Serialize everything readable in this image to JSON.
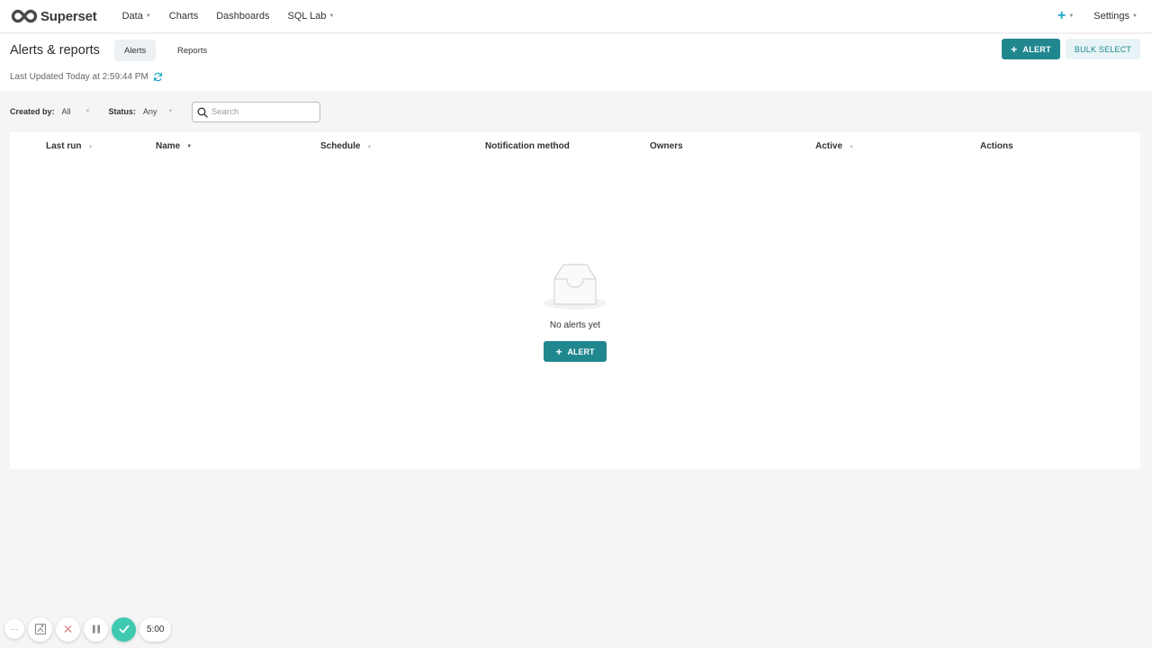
{
  "brand": {
    "name": "Superset"
  },
  "nav": {
    "items": [
      {
        "label": "Data",
        "dropdown": true
      },
      {
        "label": "Charts",
        "dropdown": false
      },
      {
        "label": "Dashboards",
        "dropdown": false
      },
      {
        "label": "SQL Lab",
        "dropdown": true
      }
    ],
    "settings_label": "Settings",
    "plus_symbol": "+"
  },
  "page": {
    "title": "Alerts & reports",
    "tabs": [
      {
        "label": "Alerts",
        "active": true
      },
      {
        "label": "Reports",
        "active": false
      }
    ],
    "alert_button": "ALERT",
    "bulk_select_button": "BULK SELECT",
    "last_updated": "Last Updated Today at 2:59:44 PM"
  },
  "filters": {
    "created_by_label": "Created by:",
    "created_by_value": "All",
    "status_label": "Status:",
    "status_value": "Any",
    "search_placeholder": "Search"
  },
  "table": {
    "columns": [
      {
        "label": "Last run",
        "sortable": true
      },
      {
        "label": "Name",
        "sortable": true,
        "sorted": "desc"
      },
      {
        "label": "Schedule",
        "sortable": true
      },
      {
        "label": "Notification method",
        "sortable": false
      },
      {
        "label": "Owners",
        "sortable": false
      },
      {
        "label": "Active",
        "sortable": true
      },
      {
        "label": "Actions",
        "sortable": false
      }
    ],
    "rows": []
  },
  "empty_state": {
    "message": "No alerts yet",
    "button": "ALERT"
  },
  "recorder": {
    "timer": "5:00",
    "more_label": "···"
  },
  "colors": {
    "primary": "#20878f",
    "accent": "#20a7c9",
    "recorder_done": "#3ec9b0"
  }
}
